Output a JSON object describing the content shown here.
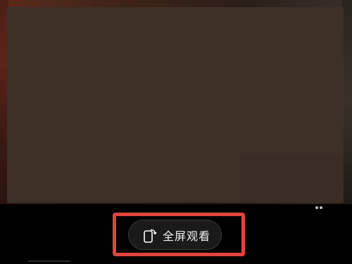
{
  "player": {
    "fullscreen_button": {
      "label": "全屏观看",
      "icon": "rotate-phone-icon"
    },
    "highlight_color": "#e0443e"
  }
}
